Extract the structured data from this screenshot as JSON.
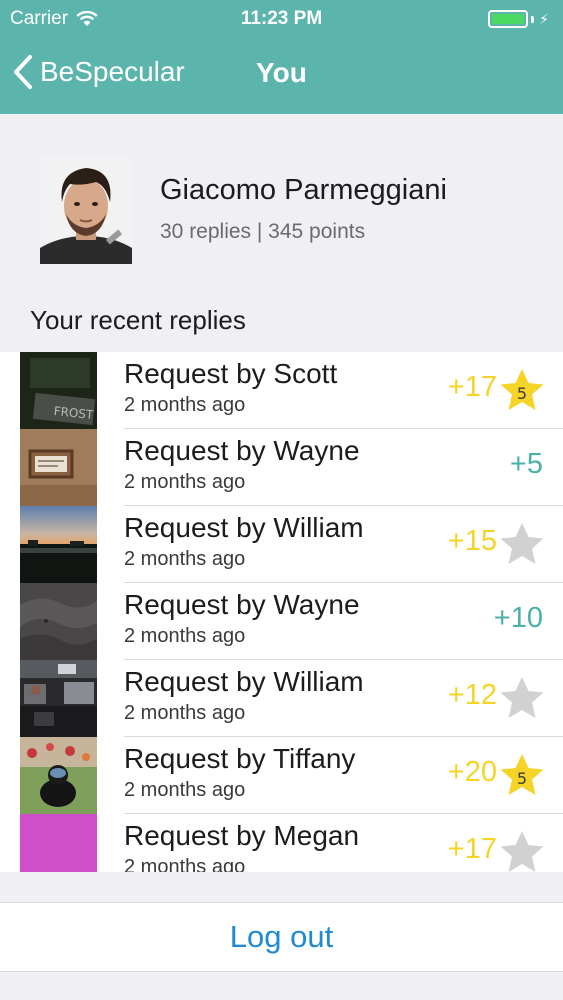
{
  "status_bar": {
    "carrier": "Carrier",
    "time": "11:23 PM",
    "icons": [
      "wifi-icon",
      "battery-icon",
      "charging-bolt-icon"
    ]
  },
  "nav": {
    "back_label": "BeSpecular",
    "title": "You"
  },
  "colors": {
    "accent": "#5cb5ad",
    "gold": "#f5d327",
    "teal_points": "#4ab0a8",
    "link_blue": "#1e8ad6"
  },
  "profile": {
    "name": "Giacomo Parmeggiani",
    "stats": "30 replies | 345 points"
  },
  "section_title": "Your recent replies",
  "replies": [
    {
      "title": "Request by Scott",
      "time": "2 months ago",
      "points": "+17",
      "star": "gold",
      "star_value": "5",
      "thumb": "dark-sign"
    },
    {
      "title": "Request by Wayne",
      "time": "2 months ago",
      "points": "+5",
      "star": "none",
      "star_value": "",
      "thumb": "frame-wall"
    },
    {
      "title": "Request by William",
      "time": "2 months ago",
      "points": "+15",
      "star": "gray",
      "star_value": "",
      "thumb": "sunset"
    },
    {
      "title": "Request by Wayne",
      "time": "2 months ago",
      "points": "+10",
      "star": "none",
      "star_value": "",
      "thumb": "dark-fabric"
    },
    {
      "title": "Request by William",
      "time": "2 months ago",
      "points": "+12",
      "star": "gray",
      "star_value": "",
      "thumb": "office"
    },
    {
      "title": "Request by Tiffany",
      "time": "2 months ago",
      "points": "+20",
      "star": "gold",
      "star_value": "5",
      "thumb": "dog-garden"
    },
    {
      "title": "Request by Megan",
      "time": "2 months ago",
      "points": "+17",
      "star": "gray",
      "star_value": "",
      "thumb": "magenta"
    }
  ],
  "logout_label": "Log out"
}
